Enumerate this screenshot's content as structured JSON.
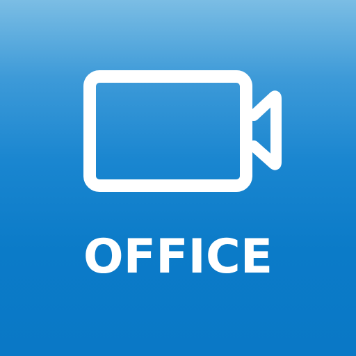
{
  "app_icon": {
    "label": "OFFICE",
    "icon": "video-camera-icon",
    "colors": {
      "background_top": "#7bbde4",
      "background_bottom": "#0a78c6",
      "foreground": "#ffffff"
    }
  }
}
